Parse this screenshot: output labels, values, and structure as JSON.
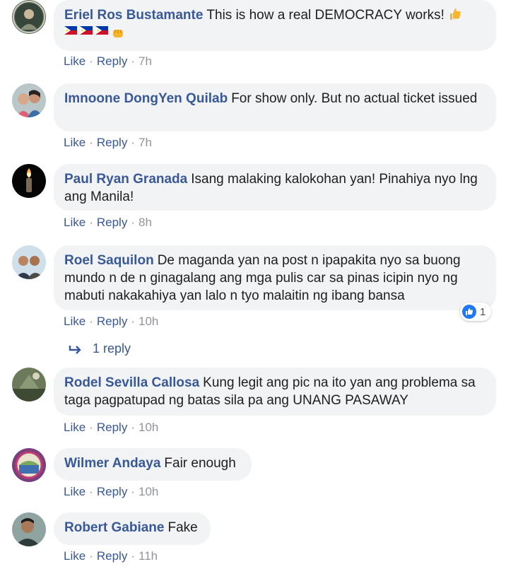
{
  "comments": [
    {
      "author": "Eriel Ros Bustamante",
      "text": "This is how a real DEMOCRACY works!",
      "like": "Like",
      "reply": "Reply",
      "time": "7h"
    },
    {
      "author": "Imnoone DongYen Quilab",
      "text": "For show only. But no actual ticket issued",
      "like": "Like",
      "reply": "Reply",
      "time": "7h"
    },
    {
      "author": "Paul Ryan Granada",
      "text": "Isang malaking kalokohan yan! Pinahiya nyo lng ang Manila!",
      "like": "Like",
      "reply": "Reply",
      "time": "8h"
    },
    {
      "author": "Roel Saquilon",
      "text": "De maganda yan na post n ipapakita nyo sa buong mundo n de n ginagalang ang mga pulis car sa pinas icipin nyo ng mabuti nakakahiya yan lalo n tyo malaitin ng ibang bansa",
      "like": "Like",
      "reply": "Reply",
      "time": "10h",
      "reaction_count": "1",
      "replies_label": "1 reply"
    },
    {
      "author": "Rodel Sevilla Callosa",
      "text": "Kung legit ang pic na ito yan ang problema sa taga pagpatupad ng batas sila pa ang UNANG PASAWAY",
      "like": "Like",
      "reply": "Reply",
      "time": "10h"
    },
    {
      "author": "Wilmer Andaya",
      "text": "Fair enough",
      "like": "Like",
      "reply": "Reply",
      "time": "10h"
    },
    {
      "author": "Robert Gabiane",
      "text": "Fake",
      "like": "Like",
      "reply": "Reply",
      "time": "11h"
    }
  ],
  "icons": {
    "emoji_1": "thumbs-up-emoji",
    "emoji_2": "philippines-flag-emoji",
    "emoji_3": "fist-emoji",
    "reaction": "like-reaction-icon",
    "reply_arrow": "reply-arrow-icon"
  },
  "colors": {
    "author": "#385898",
    "bubble": "#f2f3f5",
    "like_blue": "#2078f4"
  }
}
